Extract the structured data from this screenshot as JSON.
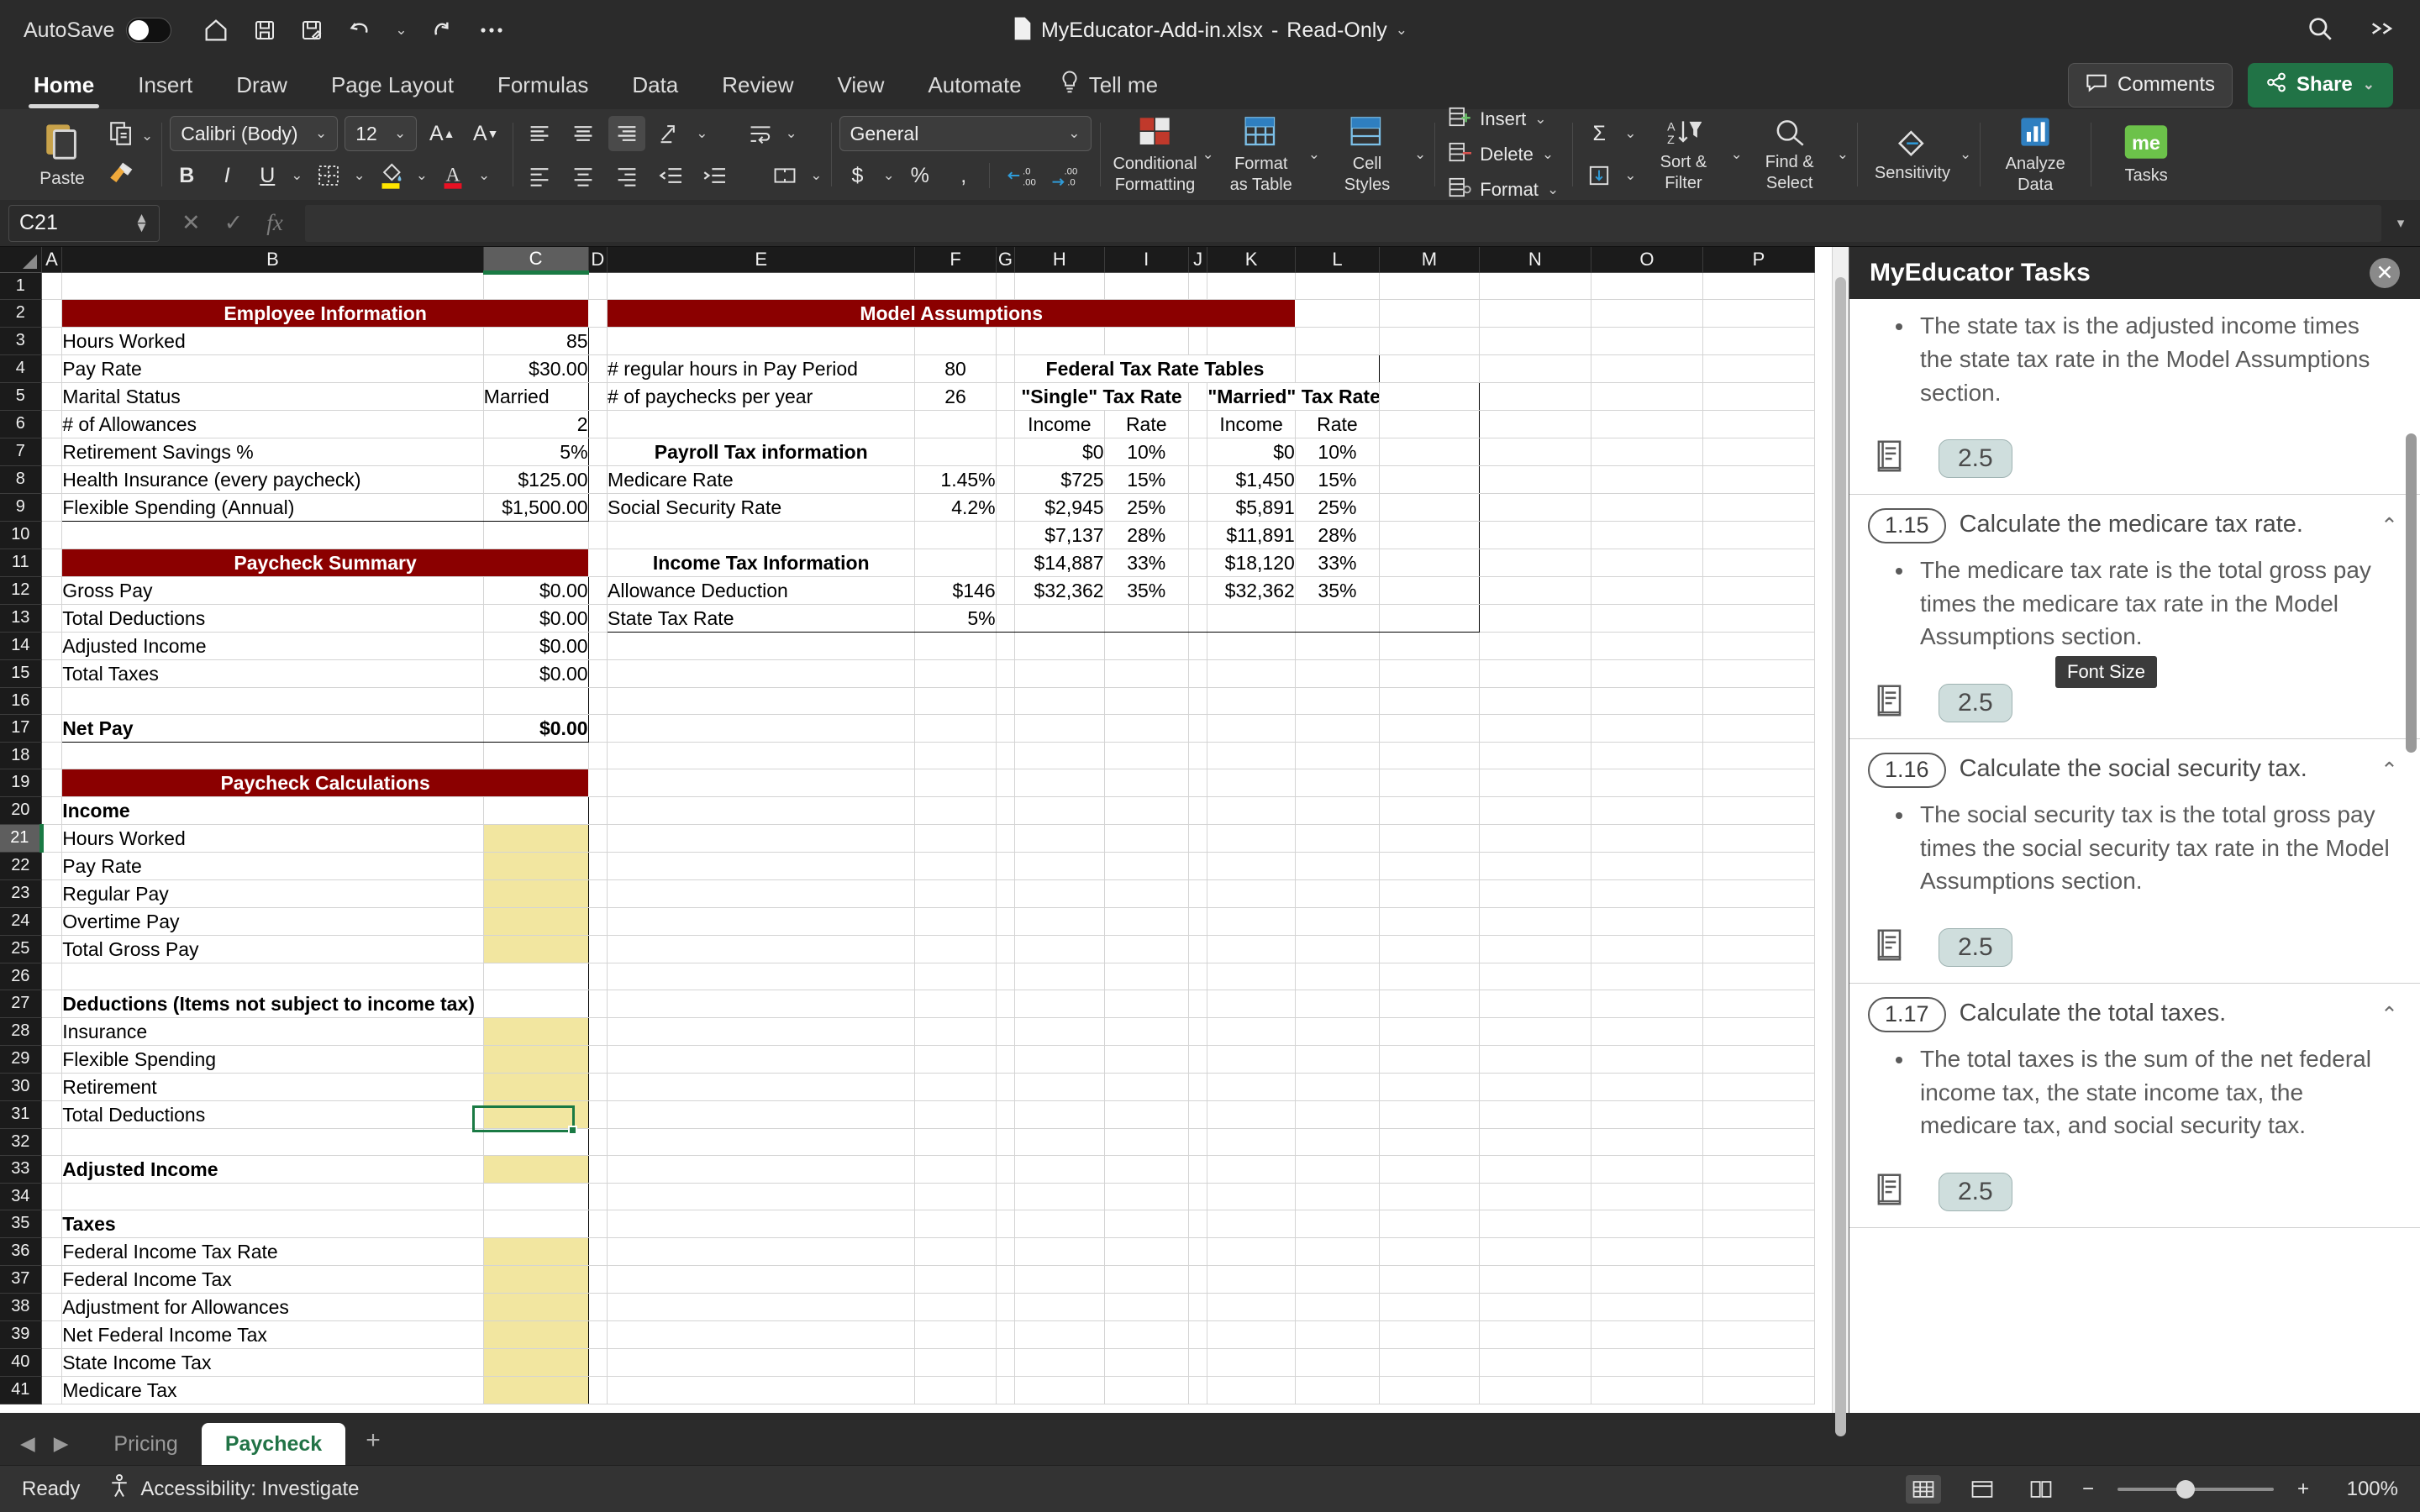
{
  "titlebar": {
    "autosave_label": "AutoSave",
    "document_title": "MyEducator-Add-in.xlsx",
    "separator": "-",
    "read_only": "Read-Only"
  },
  "ribbon_tabs": {
    "tabs": [
      "Home",
      "Insert",
      "Draw",
      "Page Layout",
      "Formulas",
      "Data",
      "Review",
      "View",
      "Automate"
    ],
    "active": "Home",
    "tell_me": "Tell me",
    "comments": "Comments",
    "share": "Share"
  },
  "ribbon": {
    "paste": "Paste",
    "font_name": "Calibri (Body)",
    "font_size": "12",
    "number_format": "General",
    "conditional_formatting": "Conditional\nFormatting",
    "conditional_formatting_l1": "Conditional",
    "conditional_formatting_l2": "Formatting",
    "format_as_table_l1": "Format",
    "format_as_table_l2": "as Table",
    "cell_styles_l1": "Cell",
    "cell_styles_l2": "Styles",
    "insert": "Insert",
    "delete": "Delete",
    "format": "Format",
    "sort_filter_l1": "Sort &",
    "sort_filter_l2": "Filter",
    "find_select_l1": "Find &",
    "find_select_l2": "Select",
    "sensitivity": "Sensitivity",
    "analyze_data_l1": "Analyze",
    "analyze_data_l2": "Data",
    "tasks": "Tasks",
    "addin_logo": "me"
  },
  "formula_bar": {
    "name_box": "C21",
    "formula": ""
  },
  "grid": {
    "column_headers": [
      "A",
      "B",
      "C",
      "D",
      "E",
      "F",
      "G",
      "H",
      "I",
      "J",
      "K",
      "L",
      "M",
      "N",
      "O",
      "P"
    ],
    "selected_column": "C",
    "selected_cell": "C21",
    "row_numbers": [
      1,
      2,
      3,
      4,
      5,
      6,
      7,
      8,
      9,
      10,
      11,
      12,
      13,
      14,
      15,
      16,
      17,
      18,
      19,
      20,
      21,
      22,
      23,
      24,
      25,
      26,
      27,
      28,
      29,
      30,
      31,
      32,
      33,
      34,
      35,
      36,
      37,
      38,
      39,
      40,
      41
    ],
    "sections": {
      "employee_information_title": "Employee Information",
      "paycheck_summary_title": "Paycheck Summary",
      "paycheck_calculations_title": "Paycheck Calculations",
      "model_assumptions_title": "Model Assumptions",
      "federal_tax_rate_tables_title": "Federal Tax Rate Tables",
      "single_tax_rate_title": "\"Single\" Tax Rate",
      "married_tax_rate_title": "\"Married\" Tax Rate",
      "payroll_tax_information_title": "Payroll Tax information",
      "income_tax_information_title": "Income Tax Information"
    },
    "employee_information": [
      {
        "row": 3,
        "label": "Hours Worked",
        "value": "85"
      },
      {
        "row": 4,
        "label": "Pay Rate",
        "value": "$30.00"
      },
      {
        "row": 5,
        "label": "Marital Status",
        "value": "Married"
      },
      {
        "row": 6,
        "label": "# of Allowances",
        "value": "2"
      },
      {
        "row": 7,
        "label": "Retirement Savings %",
        "value": "5%"
      },
      {
        "row": 8,
        "label": "Health Insurance (every paycheck)",
        "value": "$125.00"
      },
      {
        "row": 9,
        "label": "Flexible Spending (Annual)",
        "value": "$1,500.00"
      }
    ],
    "paycheck_summary": [
      {
        "row": 12,
        "label": "Gross Pay",
        "value": "$0.00",
        "bold": false
      },
      {
        "row": 13,
        "label": "Total Deductions",
        "value": "$0.00",
        "bold": false
      },
      {
        "row": 14,
        "label": "Adjusted Income",
        "value": "$0.00",
        "bold": false
      },
      {
        "row": 15,
        "label": "Total Taxes",
        "value": "$0.00",
        "bold": false
      },
      {
        "row": 17,
        "label": "Net Pay",
        "value": "$0.00",
        "bold": true
      }
    ],
    "paycheck_calculations": [
      {
        "row": 20,
        "label": "Income",
        "value": "",
        "bold": true,
        "fill": false
      },
      {
        "row": 21,
        "label": "Hours Worked",
        "value": "",
        "bold": false,
        "fill": true
      },
      {
        "row": 22,
        "label": "Pay Rate",
        "value": "",
        "bold": false,
        "fill": true
      },
      {
        "row": 23,
        "label": "Regular Pay",
        "value": "",
        "bold": false,
        "fill": true
      },
      {
        "row": 24,
        "label": "Overtime Pay",
        "value": "",
        "bold": false,
        "fill": true
      },
      {
        "row": 25,
        "label": "Total Gross Pay",
        "value": "",
        "bold": false,
        "fill": true
      },
      {
        "row": 26,
        "label": "",
        "value": "",
        "bold": false,
        "fill": false
      },
      {
        "row": 27,
        "label": "Deductions (Items not subject to income tax)",
        "value": "",
        "bold": true,
        "fill": false
      },
      {
        "row": 28,
        "label": "Insurance",
        "value": "",
        "bold": false,
        "fill": true
      },
      {
        "row": 29,
        "label": "Flexible Spending",
        "value": "",
        "bold": false,
        "fill": true
      },
      {
        "row": 30,
        "label": "Retirement",
        "value": "",
        "bold": false,
        "fill": true
      },
      {
        "row": 31,
        "label": "Total Deductions",
        "value": "",
        "bold": false,
        "fill": true
      },
      {
        "row": 32,
        "label": "",
        "value": "",
        "bold": false,
        "fill": false
      },
      {
        "row": 33,
        "label": "Adjusted Income",
        "value": "",
        "bold": true,
        "fill": true
      },
      {
        "row": 34,
        "label": "",
        "value": "",
        "bold": false,
        "fill": false
      },
      {
        "row": 35,
        "label": "Taxes",
        "value": "",
        "bold": true,
        "fill": false
      },
      {
        "row": 36,
        "label": "Federal Income Tax Rate",
        "value": "",
        "bold": false,
        "fill": true
      },
      {
        "row": 37,
        "label": "Federal Income Tax",
        "value": "",
        "bold": false,
        "fill": true
      },
      {
        "row": 38,
        "label": "Adjustment for Allowances",
        "value": "",
        "bold": false,
        "fill": true
      },
      {
        "row": 39,
        "label": "Net Federal Income Tax",
        "value": "",
        "bold": false,
        "fill": true
      },
      {
        "row": 40,
        "label": "State Income Tax",
        "value": "",
        "bold": false,
        "fill": true
      },
      {
        "row": 41,
        "label": "Medicare Tax",
        "value": "",
        "bold": false,
        "fill": true
      }
    ],
    "model_assumptions": [
      {
        "row": 4,
        "label": "# regular hours in Pay Period",
        "value": "80"
      },
      {
        "row": 5,
        "label": "# of paychecks per year",
        "value": "26"
      }
    ],
    "payroll_tax_information": [
      {
        "row": 8,
        "label": "Medicare Rate",
        "value": "1.45%"
      },
      {
        "row": 9,
        "label": "Social Security Rate",
        "value": "4.2%"
      }
    ],
    "income_tax_information": [
      {
        "row": 12,
        "label": "Allowance Deduction",
        "value": "$146"
      },
      {
        "row": 13,
        "label": "State Tax Rate",
        "value": "5%"
      }
    ],
    "tax_table_headers": {
      "income": "Income",
      "rate": "Rate"
    },
    "single_tax_table": [
      {
        "income": "$0",
        "rate": "10%"
      },
      {
        "income": "$725",
        "rate": "15%"
      },
      {
        "income": "$2,945",
        "rate": "25%"
      },
      {
        "income": "$7,137",
        "rate": "28%"
      },
      {
        "income": "$14,887",
        "rate": "33%"
      },
      {
        "income": "$32,362",
        "rate": "35%"
      }
    ],
    "married_tax_table": [
      {
        "income": "$0",
        "rate": "10%"
      },
      {
        "income": "$1,450",
        "rate": "15%"
      },
      {
        "income": "$5,891",
        "rate": "25%"
      },
      {
        "income": "$11,891",
        "rate": "28%"
      },
      {
        "income": "$18,120",
        "rate": "33%"
      },
      {
        "income": "$32,362",
        "rate": "35%"
      }
    ]
  },
  "task_pane": {
    "title": "MyEducator Tasks",
    "tooltip": "Font Size",
    "partial_task": {
      "bullet": "The state tax is the adjusted income times the state tax rate in the Model Assumptions section.",
      "points": "2.5"
    },
    "tasks": [
      {
        "number": "1.15",
        "title": "Calculate the medicare tax rate.",
        "bullets": [
          "The medicare tax rate is the total gross pay times the medicare tax rate in the Model Assumptions section."
        ],
        "points": "2.5"
      },
      {
        "number": "1.16",
        "title": "Calculate the social security tax.",
        "bullets": [
          "The social security tax is the total gross pay times the social security tax rate in the Model Assumptions section."
        ],
        "points": "2.5"
      },
      {
        "number": "1.17",
        "title": "Calculate the total taxes.",
        "bullets": [
          "The total taxes is the sum of the net federal income tax, the state income tax, the medicare tax, and social security tax."
        ],
        "points": "2.5"
      }
    ]
  },
  "sheet_tabs": {
    "tabs": [
      "Pricing",
      "Paycheck"
    ],
    "active": "Paycheck",
    "add_label": "+"
  },
  "status_bar": {
    "ready": "Ready",
    "accessibility": "Accessibility: Investigate",
    "zoom": "100%"
  },
  "colors": {
    "header_band": "#8B0000",
    "input_fill": "#F2E6A0",
    "excel_green": "#217346",
    "selection_green": "#1A7A44"
  }
}
